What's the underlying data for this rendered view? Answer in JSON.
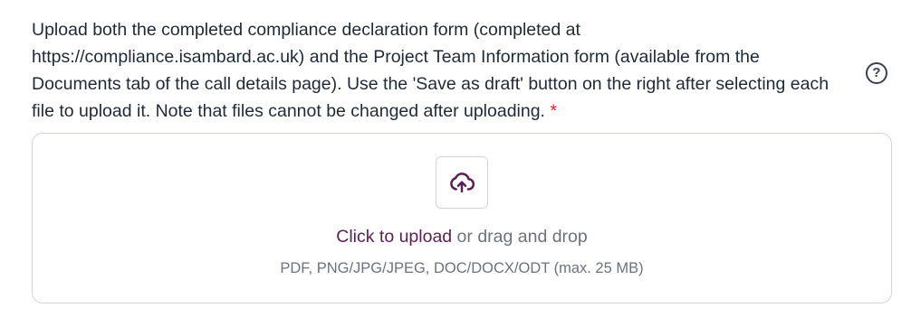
{
  "question": {
    "text": "Upload both the completed compliance declaration form (completed at https://compliance.isambard.ac.uk) and the Project Team Information form (available from the Documents tab of the call details page). Use the 'Save as draft' button on the right after selecting each file to upload it. Note that files cannot be changed after uploading.",
    "required_marker": "*"
  },
  "help": {
    "icon": "question-mark-circle-icon",
    "glyph": "?"
  },
  "upload": {
    "icon": "cloud-upload-icon",
    "link_text": "Click to upload",
    "rest_text": " or drag and drop",
    "formats": "PDF, PNG/JPG/JPEG, DOC/DOCX/ODT (max. 25 MB)"
  },
  "colors": {
    "accent": "#5a1f55",
    "required": "#dc2626",
    "muted_text": "#6b7280",
    "body_text": "#1f2937",
    "border": "#d1d5db"
  }
}
